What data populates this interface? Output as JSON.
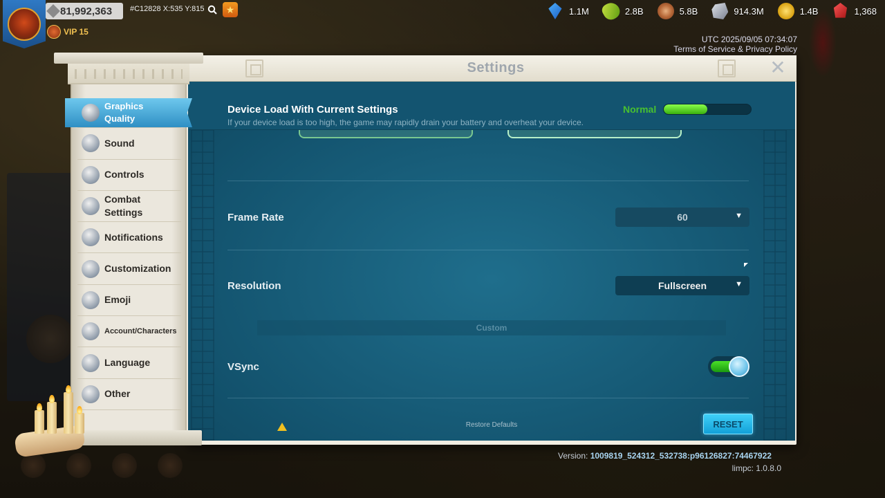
{
  "hud": {
    "power": "81,992,363",
    "coords": "#C12828 X:535 Y:815",
    "vip": "VIP 15",
    "utc": "UTC 2025/09/05 07:34:07",
    "terms": "Terms of Service & Privacy Policy",
    "resources": [
      {
        "icon": "gem-icon",
        "value": "1.1M"
      },
      {
        "icon": "food-icon",
        "value": "2.8B"
      },
      {
        "icon": "wood-icon",
        "value": "5.8B"
      },
      {
        "icon": "stone-icon",
        "value": "914.3M"
      },
      {
        "icon": "gold-icon",
        "value": "1.4B"
      },
      {
        "icon": "ruby-icon",
        "value": "1,368"
      }
    ]
  },
  "settings": {
    "title": "Settings",
    "close_label": "✕",
    "menu": [
      {
        "id": "graphics",
        "label": "Graphics Quality",
        "icon": "monitor-icon",
        "active": true
      },
      {
        "id": "sound",
        "label": "Sound",
        "icon": "speaker-icon"
      },
      {
        "id": "controls",
        "label": "Controls",
        "icon": "hand-icon"
      },
      {
        "id": "combat",
        "label": "Combat Settings",
        "icon": "swords-icon"
      },
      {
        "id": "notifications",
        "label": "Notifications",
        "icon": "horn-icon"
      },
      {
        "id": "customization",
        "label": "Customization",
        "icon": "palette-icon"
      },
      {
        "id": "emoji",
        "label": "Emoji",
        "icon": "smiley-icon"
      },
      {
        "id": "account",
        "label": "Account/Characters",
        "icon": "person-icon"
      },
      {
        "id": "language",
        "label": "Language",
        "icon": "scroll-icon"
      },
      {
        "id": "other",
        "label": "Other",
        "icon": "folder-icon"
      }
    ],
    "device_load": {
      "title": "Device Load With Current Settings",
      "desc": "If your device load is too high, the game may rapidly drain your battery and overheat your device.",
      "status": "Normal",
      "level": 0.5
    },
    "frame_rate": {
      "label": "Frame Rate",
      "value": "60"
    },
    "resolution": {
      "label": "Resolution",
      "value": "Fullscreen"
    },
    "custom_label": "Custom",
    "vsync": {
      "label": "VSync",
      "enabled": true
    },
    "restore_defaults": "Restore Defaults",
    "reset_label": "RESET"
  },
  "footer": {
    "version_prefix": "Version: ",
    "version": "1009819_524312_532738:p96126827:74467922",
    "limpc": "limpc: 1.0.8.0"
  },
  "colors": {
    "accent": "#2f8fc4",
    "load_good": "#48c030",
    "panel": "#135470"
  }
}
